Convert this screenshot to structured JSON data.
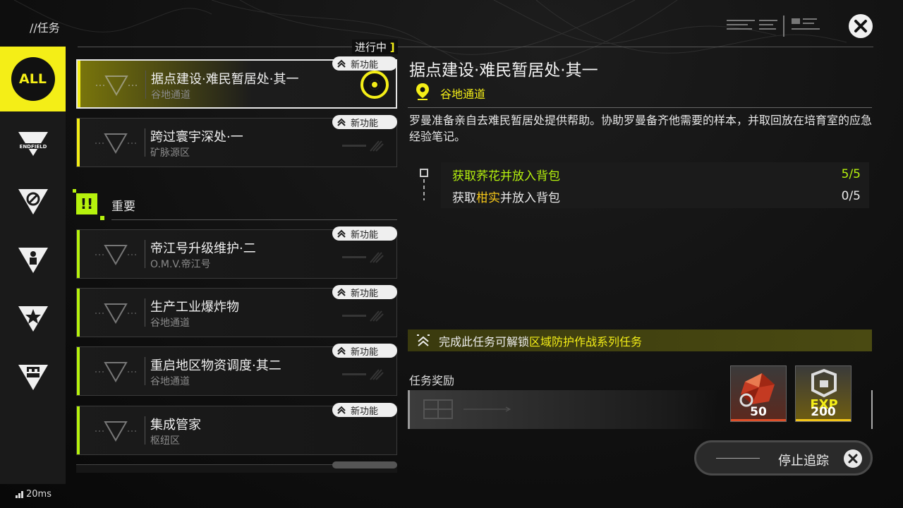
{
  "header": {
    "breadcrumb": "//任务"
  },
  "rail": {
    "items": [
      {
        "label": "ALL",
        "icon": "all-icon",
        "active": true
      },
      {
        "label": "ENDFIELD",
        "icon": "endfield-logo-icon"
      },
      {
        "icon": "no-entry-icon"
      },
      {
        "icon": "person-icon"
      },
      {
        "icon": "star-icon"
      },
      {
        "icon": "castle-icon"
      }
    ]
  },
  "list": {
    "status_label": "进行中",
    "new_feature_label": "新功能",
    "in_progress": [
      {
        "title": "据点建设·难民暂居处·其一",
        "subtitle": "谷地通道",
        "active": true
      },
      {
        "title": "跨过寰宇深处·一",
        "subtitle": "矿脉源区"
      }
    ],
    "section": {
      "icon_text": "!!",
      "label": "重要"
    },
    "important": [
      {
        "title": "帝江号升级维护·二",
        "subtitle": "O.M.V.帝江号"
      },
      {
        "title": "生产工业爆炸物",
        "subtitle": "谷地通道"
      },
      {
        "title": "重启地区物资调度·其二",
        "subtitle": "谷地通道"
      },
      {
        "title": "集成管家",
        "subtitle": "枢纽区"
      }
    ]
  },
  "detail": {
    "title": "据点建设·难民暂居处·其一",
    "location": "谷地通道",
    "description": "罗曼准备亲自去难民暂居处提供帮助。协助罗曼备齐他需要的样本，并取回放在培育室的应急经验笔记。",
    "objectives": [
      {
        "prefix": "获取荞花并放入背包",
        "highlight": "",
        "suffix": "",
        "progress": "5/5",
        "done": true
      },
      {
        "prefix": "获取",
        "highlight": "柑实",
        "suffix": "并放入背包",
        "progress": "0/5",
        "done": false
      }
    ],
    "unlock": {
      "prefix": "完成此任务可解锁",
      "highlight": "区域防护作战系列任务"
    },
    "rewards_label": "任务奖励",
    "rewards": [
      {
        "icon": "red-crystal-icon",
        "quantity": "50",
        "rarity_color": "#e0502a"
      },
      {
        "icon": "exp-icon",
        "label": "EXP",
        "quantity": "200",
        "rarity_color": "#f4c619"
      }
    ],
    "stop_tracking_label": "停止追踪"
  },
  "status": {
    "ping": "20ms"
  },
  "colors": {
    "accent_yellow": "#f4ee17",
    "accent_green": "#b6f20d",
    "highlight_orange": "#f4c619"
  }
}
